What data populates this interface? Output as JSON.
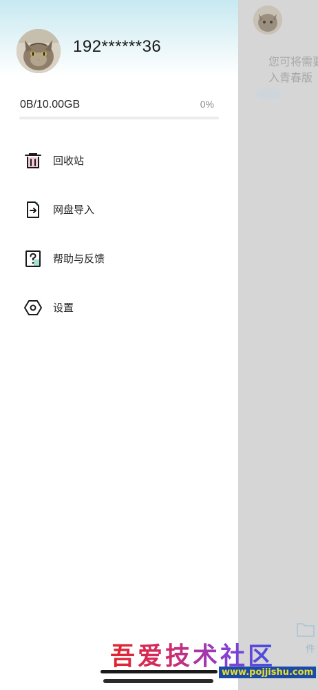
{
  "background": {
    "hint_text": "您可将需要\n入青春版",
    "file_tab_label": "件"
  },
  "drawer": {
    "username": "192******36",
    "storage": {
      "used_label": "0B/10.00GB",
      "percent_label": "0%",
      "percent": 0
    },
    "menu": [
      {
        "label": "回收站",
        "icon": "trash-icon"
      },
      {
        "label": "网盘导入",
        "icon": "file-import-icon"
      },
      {
        "label": "帮助与反馈",
        "icon": "help-icon"
      },
      {
        "label": "设置",
        "icon": "settings-hex-icon"
      }
    ]
  },
  "watermark": {
    "title": "吾爱技术社区",
    "url": "www.pojjishu.com"
  },
  "colors": {
    "accent": "#4fb3d9",
    "backdrop": "#d6d6d6",
    "header_gradient_top": "#c7e9f1"
  }
}
